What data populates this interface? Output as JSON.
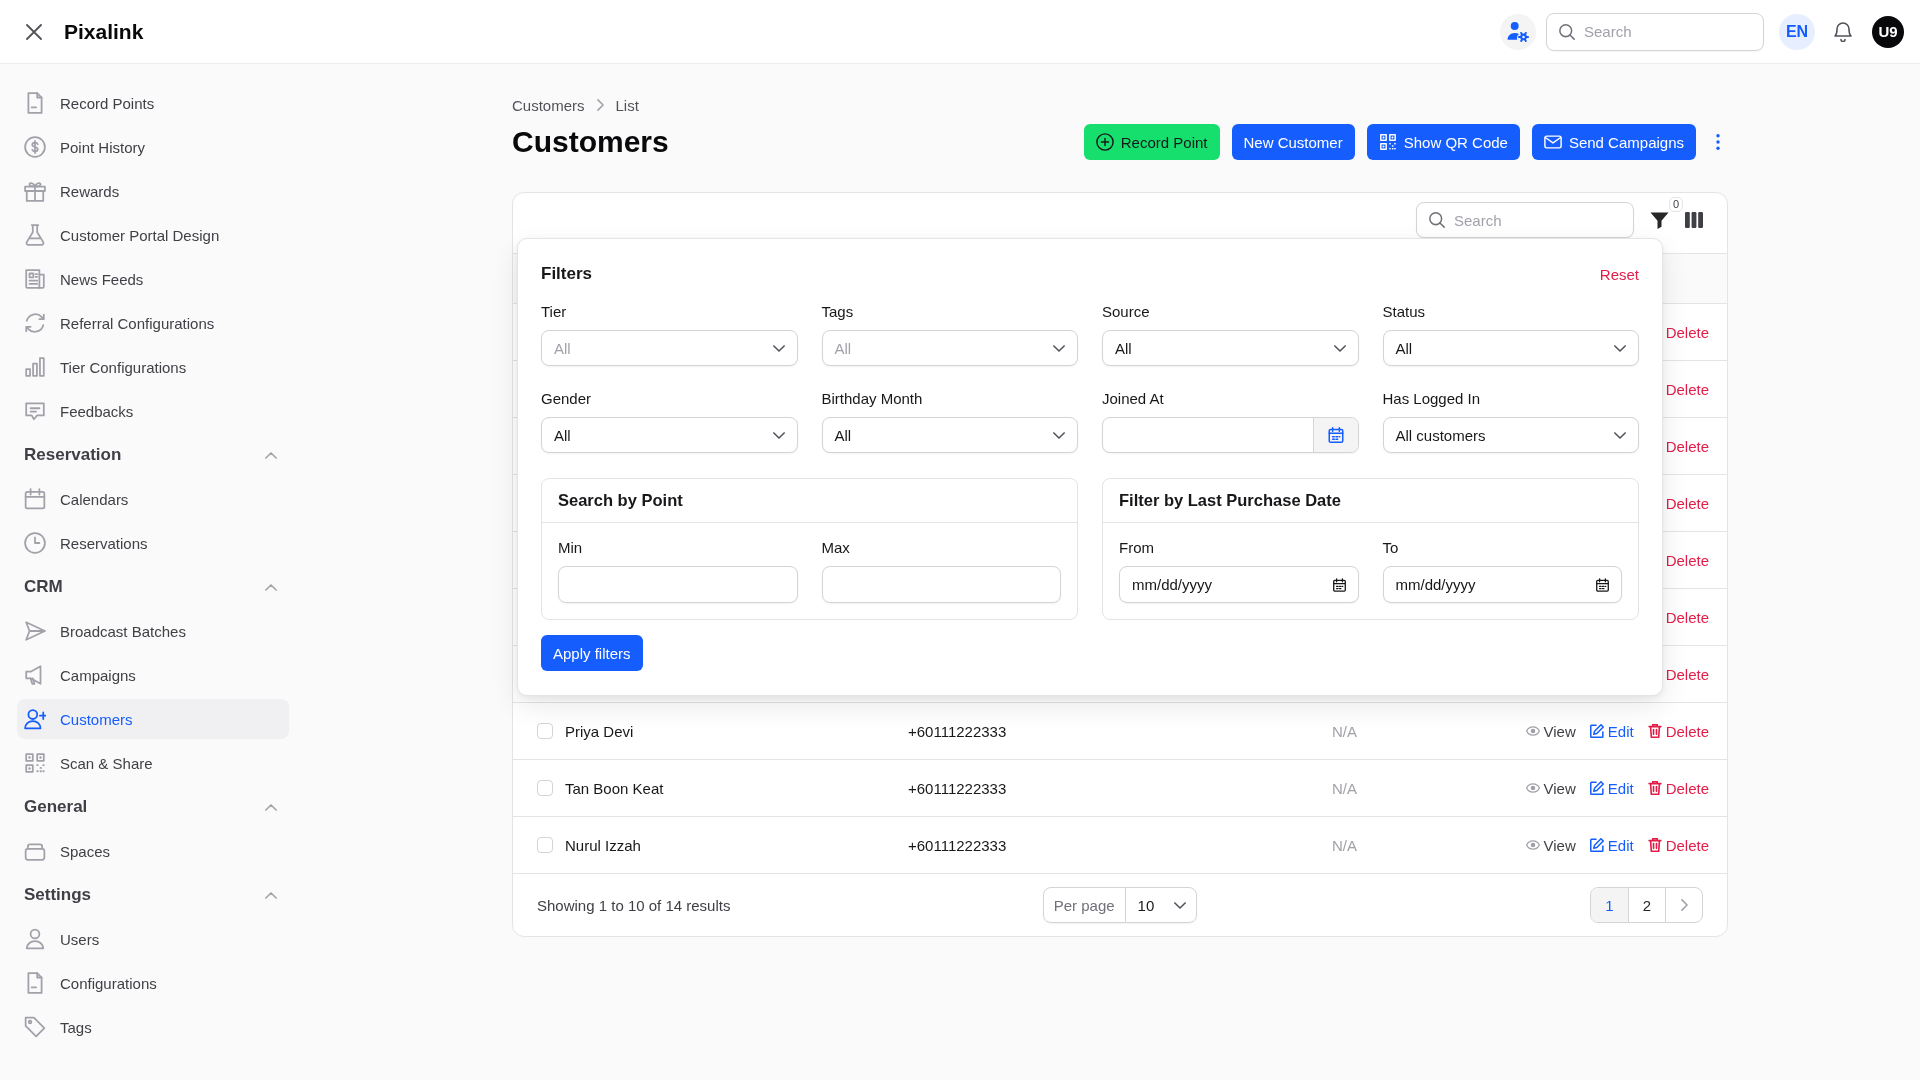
{
  "topbar": {
    "title": "Pixalink",
    "search": {
      "placeholder": "Search"
    },
    "language": "EN",
    "avatar": "U9"
  },
  "sidebar": {
    "groups": [
      {
        "items": [
          {
            "label": "Record Points",
            "selected": false
          },
          {
            "label": "Point History",
            "selected": false
          },
          {
            "label": "Rewards",
            "selected": false
          },
          {
            "label": "Customer Portal Design",
            "selected": false
          },
          {
            "label": "News Feeds",
            "selected": false
          },
          {
            "label": "Referral Configurations",
            "selected": false
          },
          {
            "label": "Tier Configurations",
            "selected": false
          },
          {
            "label": "Feedbacks",
            "selected": false
          }
        ]
      },
      {
        "title": "Reservation",
        "expanded": true,
        "items": [
          {
            "label": "Calendars",
            "selected": false
          },
          {
            "label": "Reservations",
            "selected": false
          }
        ]
      },
      {
        "title": "CRM",
        "expanded": true,
        "items": [
          {
            "label": "Broadcast Batches",
            "selected": false
          },
          {
            "label": "Campaigns",
            "selected": false
          },
          {
            "label": "Customers",
            "selected": true
          },
          {
            "label": "Scan & Share",
            "selected": false
          }
        ]
      },
      {
        "title": "General",
        "expanded": true,
        "items": [
          {
            "label": "Spaces",
            "selected": false
          }
        ]
      },
      {
        "title": "Settings",
        "expanded": true,
        "items": [
          {
            "label": "Users",
            "selected": false
          },
          {
            "label": "Configurations",
            "selected": false
          },
          {
            "label": "Tags",
            "selected": false
          }
        ]
      }
    ]
  },
  "page": {
    "breadcrumbs": [
      "Customers",
      "List"
    ],
    "title": "Customers",
    "actions": [
      {
        "label": "Record Point",
        "kind": "success"
      },
      {
        "label": "New Customer",
        "kind": "primary"
      },
      {
        "label": "Show QR Code",
        "kind": "primary"
      },
      {
        "label": "Send Campaigns",
        "kind": "primary"
      }
    ]
  },
  "table": {
    "toolbar": {
      "search": {
        "placeholder": "Search"
      },
      "filter_count": "0"
    },
    "filters": {
      "title": "Filters",
      "reset": "Reset",
      "fields": [
        {
          "label": "Tier",
          "kind": "select",
          "placeholder": "All"
        },
        {
          "label": "Tags",
          "kind": "select",
          "placeholder": "All"
        },
        {
          "label": "Source",
          "kind": "select",
          "value": "All"
        },
        {
          "label": "Status",
          "kind": "select",
          "value": "All"
        },
        {
          "label": "Gender",
          "kind": "select",
          "value": "All"
        },
        {
          "label": "Birthday Month",
          "kind": "select",
          "value": "All"
        },
        {
          "label": "Joined At",
          "kind": "date_picker"
        },
        {
          "label": "Has Logged In",
          "kind": "select",
          "value": "All customers"
        }
      ],
      "groups": [
        {
          "title": "Search by Point",
          "fields": [
            {
              "label": "Min",
              "kind": "number"
            },
            {
              "label": "Max",
              "kind": "number"
            }
          ]
        },
        {
          "title": "Filter by Last Purchase Date",
          "fields": [
            {
              "label": "From",
              "kind": "date",
              "placeholder": "mm/dd/yyyy"
            },
            {
              "label": "To",
              "kind": "date",
              "placeholder": "mm/dd/yyyy"
            }
          ]
        }
      ],
      "apply": "Apply filters"
    },
    "rows": [
      {
        "kind": "covered",
        "actions": [
          {
            "label": "Delete",
            "kind": "delete"
          }
        ]
      },
      {
        "kind": "covered",
        "actions": [
          {
            "label": "Delete",
            "kind": "delete"
          }
        ]
      },
      {
        "kind": "covered",
        "actions": [
          {
            "label": "Delete",
            "kind": "delete"
          }
        ]
      },
      {
        "kind": "covered",
        "actions": [
          {
            "label": "Delete",
            "kind": "delete"
          }
        ]
      },
      {
        "kind": "covered",
        "actions": [
          {
            "label": "Delete",
            "kind": "delete"
          }
        ]
      },
      {
        "kind": "covered",
        "actions": [
          {
            "label": "Delete",
            "kind": "delete"
          }
        ]
      },
      {
        "kind": "covered",
        "actions": [
          {
            "label": "Delete",
            "kind": "delete"
          }
        ]
      },
      {
        "kind": "full",
        "checked": false,
        "name": "Priya Devi",
        "phone": "+60111222333",
        "column_3": "N/A",
        "actions": [
          {
            "label": "View",
            "kind": "view"
          },
          {
            "label": "Edit",
            "kind": "edit"
          },
          {
            "label": "Delete",
            "kind": "delete"
          }
        ]
      },
      {
        "kind": "full",
        "checked": false,
        "name": "Tan Boon Keat",
        "phone": "+60111222333",
        "column_3": "N/A",
        "actions": [
          {
            "label": "View",
            "kind": "view"
          },
          {
            "label": "Edit",
            "kind": "edit"
          },
          {
            "label": "Delete",
            "kind": "delete"
          }
        ]
      },
      {
        "kind": "full",
        "checked": false,
        "name": "Nurul Izzah",
        "phone": "+60111222333",
        "column_3": "N/A",
        "actions": [
          {
            "label": "View",
            "kind": "view"
          },
          {
            "label": "Edit",
            "kind": "edit"
          },
          {
            "label": "Delete",
            "kind": "delete"
          }
        ]
      }
    ],
    "footer": {
      "summary": "Showing 1 to 10 of 14 results",
      "per_page_label": "Per page",
      "per_page": "10",
      "pages": [
        {
          "label": "1",
          "selected": true
        },
        {
          "label": "2",
          "selected": false
        }
      ]
    }
  }
}
